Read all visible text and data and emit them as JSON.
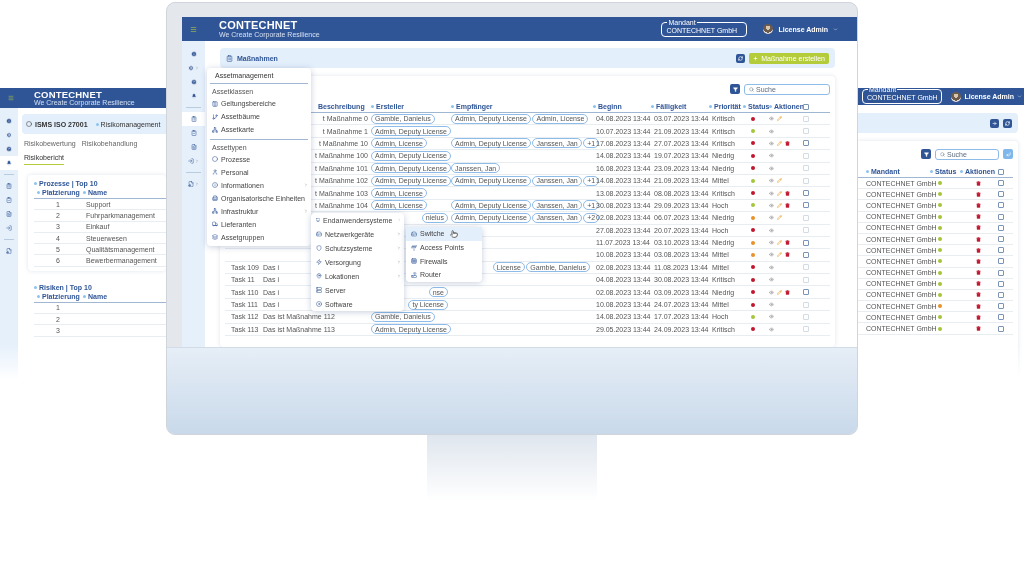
{
  "left_screen": {
    "logo": "CONTECHNET",
    "tagline": "We Create Corporate Resilience",
    "title": "ISMS ISO 27001",
    "breadcrumb": "Risikomanagement",
    "sidebar": [
      {
        "kind": "circle",
        "selected": false
      },
      {
        "kind": "circle",
        "selected": false
      },
      {
        "kind": "circle",
        "selected": false
      },
      {
        "kind": "circle",
        "selected": true
      },
      {
        "kind": "page",
        "selected": false
      },
      {
        "kind": "page",
        "selected": false
      },
      {
        "kind": "page",
        "selected": false
      },
      {
        "kind": "page",
        "selected": false
      },
      {
        "kind": "page",
        "selected": false
      }
    ],
    "tabs": [
      {
        "label": "Risikobewertung",
        "selected": false
      },
      {
        "label": "Risikobehandlung",
        "selected": false
      },
      {
        "label": "Risikobericht",
        "selected": true
      }
    ],
    "cards": [
      {
        "title": "Prozesse | Top 10",
        "columns": [
          "Platzierung",
          "Name"
        ],
        "rows": [
          {
            "rank": "1",
            "name": "Support"
          },
          {
            "rank": "2",
            "name": "Fuhrparkmanagement"
          },
          {
            "rank": "3",
            "name": "Einkauf"
          },
          {
            "rank": "4",
            "name": "Steuerwesen"
          },
          {
            "rank": "5",
            "name": "Qualitätsmanagement"
          },
          {
            "rank": "6",
            "name": "Bewerbermanagement"
          }
        ]
      },
      {
        "title": "Risiken | Top 10",
        "columns": [
          "Platzierung",
          "Name"
        ],
        "rows": [
          {
            "rank": "1"
          },
          {
            "rank": "2"
          },
          {
            "rank": "3"
          }
        ]
      }
    ]
  },
  "main": {
    "header": {
      "logo": "CONTECHNET",
      "tagline": "We Create Corporate Resilience",
      "mandant_label": "Mandant",
      "mandant": "CONTECHNET GmbH",
      "user": "License Admin"
    },
    "sidebar": [
      {
        "kind": "circle",
        "selected": false,
        "submenu": false
      },
      {
        "kind": "circle",
        "selected": false,
        "submenu": true
      },
      {
        "kind": "circle",
        "selected": false,
        "submenu": false
      },
      {
        "kind": "circle",
        "selected": false,
        "submenu": false
      },
      {
        "kind": "page",
        "selected": true,
        "submenu": false
      },
      {
        "kind": "page",
        "selected": false,
        "submenu": false
      },
      {
        "kind": "page",
        "selected": false,
        "submenu": false
      },
      {
        "kind": "page",
        "selected": false,
        "submenu": true
      },
      {
        "kind": "page",
        "selected": false,
        "submenu": true
      }
    ],
    "page_title": "Maßnahmen",
    "create_button": "Maßnahme erstellen",
    "search": {
      "placeholder": "Suche"
    },
    "select_all": {
      "checked": false
    },
    "columns": [
      "Beschreibung",
      "Ersteller",
      "Empfänger",
      "Beginn",
      "Fälligkeit",
      "Priorität",
      "Status",
      "Aktionen"
    ],
    "rows": [
      {
        "description": "t Maßnahme 0",
        "desc_cut": true,
        "creators": [
          "Gamble, Danielus"
        ],
        "recipients": [
          "Admin, Deputy License",
          "Admin, License"
        ],
        "start": "04.08.2023 13:44",
        "due": "03.07.2023 13:44",
        "priority": "Kritisch",
        "color": "#c0172f",
        "editable": true,
        "deletable": false,
        "disabled": true
      },
      {
        "description": "t Maßnahme 1",
        "desc_cut": true,
        "creators": [
          "Admin, Deputy License"
        ],
        "recipients": [],
        "start": "10.07.2023 13:44",
        "due": "21.09.2023 13:44",
        "priority": "Kritisch",
        "color": "#a4c639",
        "editable": false,
        "deletable": false,
        "disabled": true
      },
      {
        "description": "t Maßnahme 10",
        "desc_cut": true,
        "creators": [
          "Admin, License"
        ],
        "recipients": [
          "Admin, Deputy License",
          "Janssen, Jan",
          "+1"
        ],
        "start": "17.08.2023 13:44",
        "due": "27.07.2023 13:44",
        "priority": "Kritisch",
        "color": "#c0172f",
        "editable": true,
        "deletable": true,
        "disabled": false
      },
      {
        "description": "t Maßnahme 100",
        "desc_cut": true,
        "creators": [
          "Admin, Deputy License"
        ],
        "recipients": [],
        "start": "14.08.2023 13:44",
        "due": "19.07.2023 13:44",
        "priority": "Niedrig",
        "color": "#c0172f",
        "editable": false,
        "deletable": false,
        "disabled": true
      },
      {
        "description": "t Maßnahme 101",
        "desc_cut": true,
        "creators": [
          "Admin, Deputy License"
        ],
        "recipients": [
          "Janssen, Jan"
        ],
        "start": "16.08.2023 13:44",
        "due": "23.09.2023 13:44",
        "priority": "Niedrig",
        "color": "#c0172f",
        "editable": false,
        "deletable": false,
        "disabled": true
      },
      {
        "description": "t Maßnahme 102",
        "desc_cut": true,
        "creators": [
          "Admin, Deputy License"
        ],
        "recipients": [
          "Admin, Deputy License",
          "Janssen, Jan",
          "+1"
        ],
        "start": "14.08.2023 13:44",
        "due": "21.09.2023 13:44",
        "priority": "Mittel",
        "color": "#a4c639",
        "editable": true,
        "deletable": false,
        "disabled": true
      },
      {
        "description": "t Maßnahme 103",
        "desc_cut": true,
        "creators": [
          "Admin, License"
        ],
        "recipients": [],
        "start": "13.08.2023 13:44",
        "due": "08.08.2023 13:44",
        "priority": "Kritisch",
        "color": "#c0172f",
        "editable": true,
        "deletable": true,
        "disabled": false
      },
      {
        "description": "t Maßnahme 104",
        "desc_cut": true,
        "creators": [
          "Admin, License"
        ],
        "recipients": [
          "Admin, Deputy License",
          "Janssen, Jan",
          "+1"
        ],
        "start": "30.08.2023 13:44",
        "due": "29.09.2023 13:44",
        "priority": "Hoch",
        "color": "#a4c639",
        "editable": true,
        "deletable": true,
        "disabled": false
      },
      {
        "creators": [
          "nielus"
        ],
        "creators_cut": true,
        "recipients": [
          "Admin, Deputy License",
          "Janssen, Jan",
          "+2"
        ],
        "start": "02.08.2023 13:44",
        "due": "06.07.2023 13:44",
        "priority": "Niedrig",
        "color": "#e8922b",
        "editable": true,
        "deletable": false,
        "disabled": true
      },
      {
        "creators": [],
        "recipients": [],
        "start": "27.08.2023 13:44",
        "due": "20.07.2023 13:44",
        "priority": "Hoch",
        "color": "#c0172f",
        "editable": false,
        "deletable": false,
        "disabled": true
      },
      {
        "creators": [],
        "recipients": [],
        "start": "11.07.2023 13:44",
        "due": "03.10.2023 13:44",
        "priority": "Niedrig",
        "color": "#e8922b",
        "editable": true,
        "deletable": true,
        "disabled": false
      },
      {
        "creators": [],
        "recipients": [],
        "start": "10.08.2023 13:44",
        "due": "03.08.2023 13:44",
        "priority": "Mittel",
        "color": "#e8922b",
        "editable": true,
        "deletable": true,
        "disabled": false
      },
      {
        "task": "Task 109",
        "description": "Das i",
        "creators": [],
        "recipients": [
          "License",
          "Gamble, Danielus"
        ],
        "recipients_cut": true,
        "start": "02.08.2023 13:44",
        "due": "11.08.2023 13:44",
        "priority": "Mittel",
        "color": "#c0172f",
        "editable": false,
        "deletable": false,
        "disabled": true
      },
      {
        "task": "Task 11",
        "description": "Das i",
        "creators": [],
        "recipients": [],
        "start": "04.08.2023 13:44",
        "due": "30.08.2023 13:44",
        "priority": "Kritisch",
        "color": "#c0172f",
        "editable": false,
        "deletable": false,
        "disabled": true
      },
      {
        "task": "Task 110",
        "description": "Das i",
        "creators": [
          "nse"
        ],
        "creators_cut": true,
        "recipients": [],
        "start": "02.08.2023 13:44",
        "due": "03.09.2023 13:44",
        "priority": "Niedrig",
        "color": "#c0172f",
        "editable": true,
        "deletable": true,
        "disabled": false
      },
      {
        "task": "Task 111",
        "description": "Das i",
        "creators": [
          "ty License"
        ],
        "creators_cut": true,
        "recipients": [],
        "start": "10.08.2023 13:44",
        "due": "24.07.2023 13:44",
        "priority": "Mittel",
        "color": "#c0172f",
        "editable": false,
        "deletable": false,
        "disabled": true
      },
      {
        "task": "Task 112",
        "description": "Das ist Maßnahme 112",
        "creators": [
          "Gamble, Danielus"
        ],
        "recipients": [],
        "start": "14.08.2023 13:44",
        "due": "17.07.2023 13:44",
        "priority": "Hoch",
        "color": "#a4c639",
        "editable": false,
        "deletable": false,
        "disabled": true
      },
      {
        "task": "Task 113",
        "description": "Das ist Maßnahme 113",
        "creators": [
          "Admin, Deputy License"
        ],
        "recipients": [],
        "start": "29.05.2023 13:44",
        "due": "24.09.2023 13:44",
        "priority": "Kritisch",
        "color": "#c0172f",
        "editable": false,
        "deletable": false,
        "disabled": true
      }
    ],
    "menu": {
      "title": "Assetmanagement",
      "sections": [
        {
          "title": "Assetklassen",
          "items": [
            {
              "label": "Geltungsbereiche",
              "submenu": false
            },
            {
              "label": "Assetbäume",
              "submenu": false
            },
            {
              "label": "Assetkarte",
              "submenu": false
            }
          ]
        },
        {
          "title": "Assettypen",
          "items": [
            {
              "label": "Prozesse",
              "submenu": false
            },
            {
              "label": "Personal",
              "submenu": false
            },
            {
              "label": "Informationen",
              "submenu": true
            },
            {
              "label": "Organisatorische Einheiten",
              "submenu": false
            },
            {
              "label": "Infrastruktur",
              "submenu": true
            },
            {
              "label": "Lieferanten",
              "submenu": false
            },
            {
              "label": "Assetgruppen",
              "submenu": false
            }
          ]
        }
      ]
    },
    "submenu": [
      {
        "label": "Endanwendersysteme",
        "submenu": true
      },
      {
        "label": "Netzwerkgeräte",
        "submenu": true
      },
      {
        "label": "Schutzsysteme",
        "submenu": true
      },
      {
        "label": "Versorgung",
        "submenu": true
      },
      {
        "label": "Lokationen",
        "submenu": true
      },
      {
        "label": "Server",
        "submenu": false
      },
      {
        "label": "Software",
        "submenu": false
      }
    ],
    "submenu2": [
      {
        "label": "Switche",
        "selected": true
      },
      {
        "label": "Access Points",
        "selected": false
      },
      {
        "label": "Firewalls",
        "selected": false
      },
      {
        "label": "Router",
        "selected": false
      }
    ]
  },
  "right_screen": {
    "mandant_label": "Mandant",
    "mandant": "CONTECHNET GmbH",
    "user": "License Admin",
    "search": {
      "placeholder": "Suche"
    },
    "columns": [
      "Mandant",
      "Status",
      "Aktionen"
    ],
    "select_all": {
      "checked": false
    },
    "rows": [
      {
        "mandant": "CONTECHNET GmbH",
        "color": "#a4c639",
        "checked": false
      },
      {
        "mandant": "CONTECHNET GmbH",
        "color": "#a4c639",
        "checked": false
      },
      {
        "mandant": "CONTECHNET GmbH",
        "color": "#a4c639",
        "checked": false
      },
      {
        "mandant": "CONTECHNET GmbH",
        "color": "#a4c639",
        "checked": false
      },
      {
        "mandant": "CONTECHNET GmbH",
        "color": "#a4c639",
        "checked": false
      },
      {
        "mandant": "CONTECHNET GmbH",
        "color": "#a4c639",
        "checked": false
      },
      {
        "mandant": "CONTECHNET GmbH",
        "color": "#a4c639",
        "checked": false
      },
      {
        "mandant": "CONTECHNET GmbH",
        "color": "#a4c639",
        "checked": false
      },
      {
        "mandant": "CONTECHNET GmbH",
        "color": "#a4c639",
        "checked": false
      },
      {
        "mandant": "CONTECHNET GmbH",
        "color": "#a4c639",
        "checked": false
      },
      {
        "mandant": "CONTECHNET GmbH",
        "color": "#a4c639",
        "checked": false
      },
      {
        "mandant": "CONTECHNET GmbH",
        "color": "#e8922b",
        "checked": false
      },
      {
        "mandant": "CONTECHNET GmbH",
        "color": "#a4c639",
        "checked": false
      },
      {
        "mandant": "CONTECHNET GmbH",
        "color": "#a4c639",
        "checked": false
      }
    ]
  }
}
